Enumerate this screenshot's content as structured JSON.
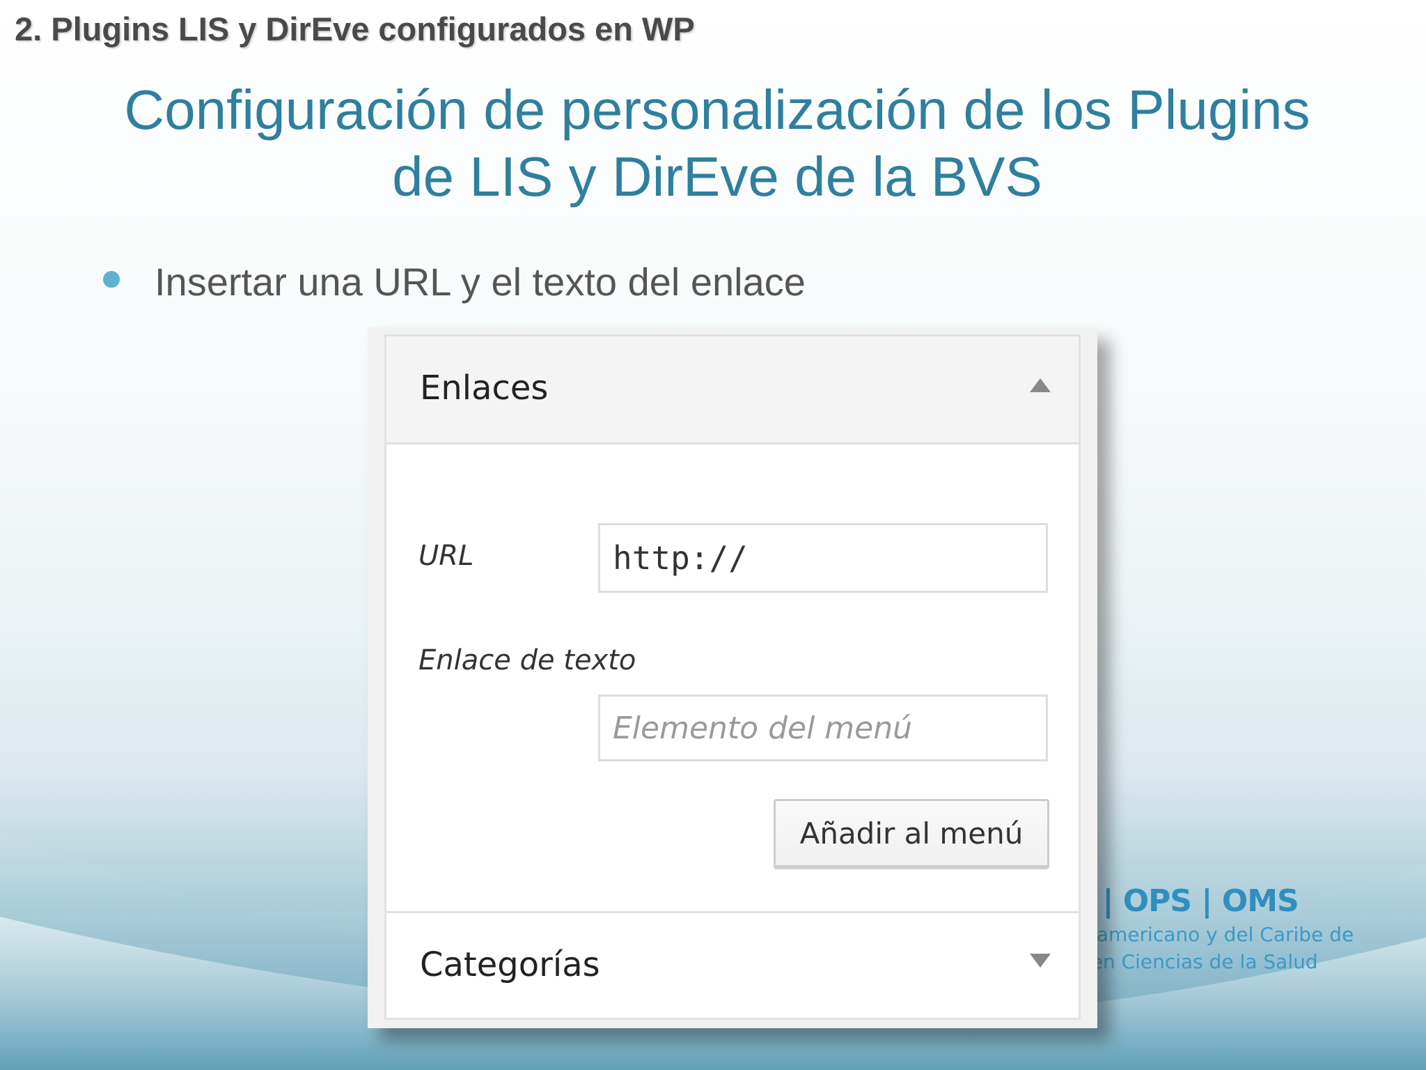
{
  "slide": {
    "section_heading": "2. Plugins LIS y DirEve configurados en WP",
    "title_line1": "Configuración de personalización de los Plugins",
    "title_line2": "de LIS y DirEve de la BVS",
    "bullet": "Insertar una URL y el texto del enlace"
  },
  "logo": {
    "line1": "E | OPS | OMS",
    "line2": "noamericano y del Caribe de",
    "line3": "n en Ciencias de la Salud"
  },
  "panel": {
    "section_title": "Enlaces",
    "section_icon": "arrow-up-icon",
    "url_label": "URL",
    "url_value": "http://",
    "text_label": "Enlace de texto",
    "text_placeholder": "Elemento del menú",
    "add_button": "Añadir al menú",
    "next_section_title": "Categorías",
    "next_section_icon": "arrow-down-icon"
  },
  "colors": {
    "title": "#2f7f9e",
    "bullet": "#5eb1d2",
    "logo": "#2f8fbf"
  }
}
